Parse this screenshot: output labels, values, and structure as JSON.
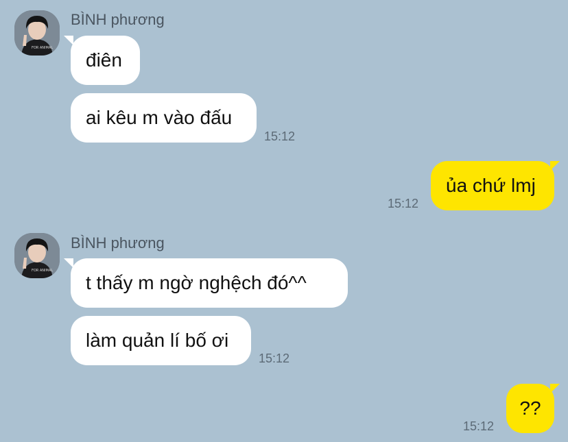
{
  "colors": {
    "background": "#abc1d1",
    "incoming_bubble": "#ffffff",
    "outgoing_bubble": "#fee500"
  },
  "messages": {
    "group1": {
      "sender": "BÌNH phương",
      "bubble1": "điên",
      "bubble2": "ai kêu m vào đấu",
      "time": "15:12"
    },
    "reply1": {
      "text": "ủa chứ lmj",
      "time": "15:12"
    },
    "group2": {
      "sender": "BÌNH phương",
      "bubble1": "t thấy m ngờ nghệch đó^^",
      "bubble2": "làm quản lí bố ơi",
      "time": "15:12"
    },
    "reply2": {
      "text": "??",
      "time": "15:12"
    }
  }
}
